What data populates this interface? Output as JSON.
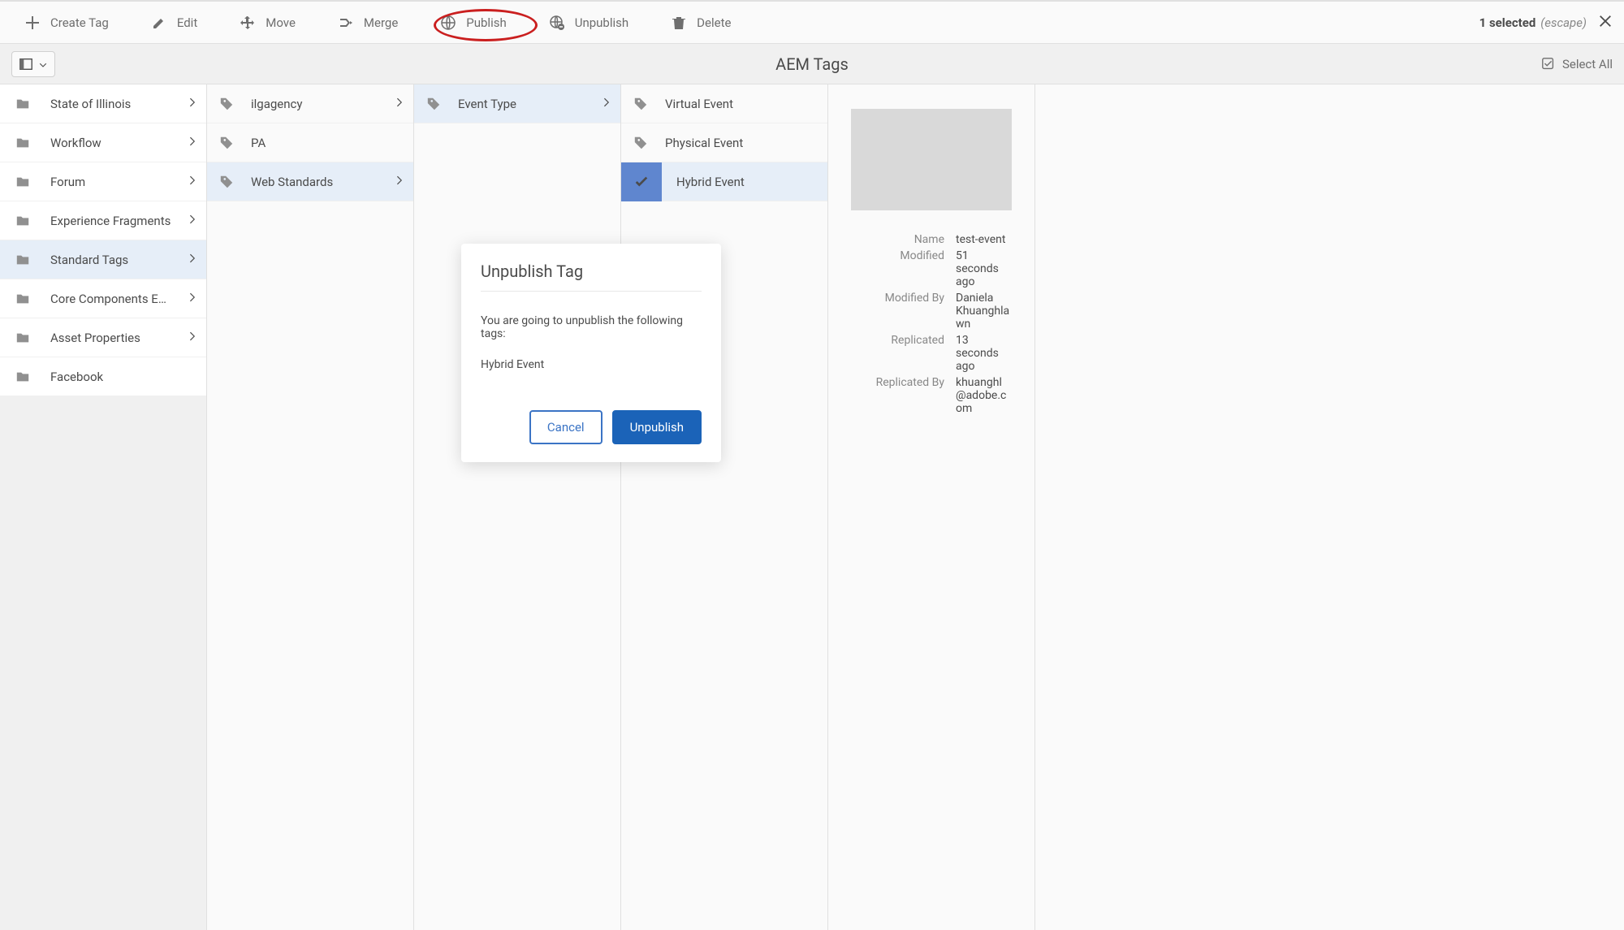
{
  "actionbar": {
    "items": [
      {
        "label": "Create Tag",
        "icon": "plus"
      },
      {
        "label": "Edit",
        "icon": "pencil"
      },
      {
        "label": "Move",
        "icon": "move"
      },
      {
        "label": "Merge",
        "icon": "merge"
      },
      {
        "label": "Publish",
        "icon": "globe"
      },
      {
        "label": "Unpublish",
        "icon": "globe-x"
      },
      {
        "label": "Delete",
        "icon": "trash"
      }
    ],
    "selected_count": "1 selected",
    "escape_hint": "(escape)"
  },
  "titlebar": {
    "page_title": "AEM Tags",
    "select_all": "Select All"
  },
  "columns": {
    "col0": [
      {
        "label": "State of Illinois",
        "icon": "folder",
        "chevron": true
      },
      {
        "label": "Workflow",
        "icon": "folder",
        "chevron": true
      },
      {
        "label": "Forum",
        "icon": "folder",
        "chevron": true
      },
      {
        "label": "Experience Fragments",
        "icon": "folder",
        "chevron": true
      },
      {
        "label": "Standard Tags",
        "icon": "folder",
        "chevron": true,
        "selected": true
      },
      {
        "label": "Core Components Exa…",
        "icon": "folder",
        "chevron": true
      },
      {
        "label": "Asset Properties",
        "icon": "folder",
        "chevron": true
      },
      {
        "label": "Facebook",
        "icon": "folder",
        "chevron": false
      }
    ],
    "col1": [
      {
        "label": "ilgagency",
        "icon": "tag",
        "chevron": true
      },
      {
        "label": "PA",
        "icon": "tag",
        "chevron": false
      },
      {
        "label": "Web Standards",
        "icon": "tag",
        "chevron": true,
        "selected": true
      }
    ],
    "col2": [
      {
        "label": "Event Type",
        "icon": "tag",
        "chevron": true,
        "selected": true
      }
    ],
    "col3": [
      {
        "label": "Virtual Event",
        "icon": "tag",
        "chevron": false
      },
      {
        "label": "Physical Event",
        "icon": "tag",
        "chevron": false
      },
      {
        "label": "Hybrid Event",
        "icon": "check",
        "chevron": false,
        "checked": true
      }
    ]
  },
  "detail": {
    "name_k": "Name",
    "name_v": "test-event",
    "modified_k": "Modified",
    "modified_v": "51 seconds ago",
    "modifiedby_k": "Modified By",
    "modifiedby_v": "Daniela Khuanghlawn",
    "replicated_k": "Replicated",
    "replicated_v": "13 seconds ago",
    "replicatedby_k": "Replicated By",
    "replicatedby_v": "khuanghl@adobe.com"
  },
  "dialog": {
    "title": "Unpublish Tag",
    "message": "You are going to unpublish the following tags:",
    "tag": "Hybrid Event",
    "cancel": "Cancel",
    "confirm": "Unpublish"
  }
}
